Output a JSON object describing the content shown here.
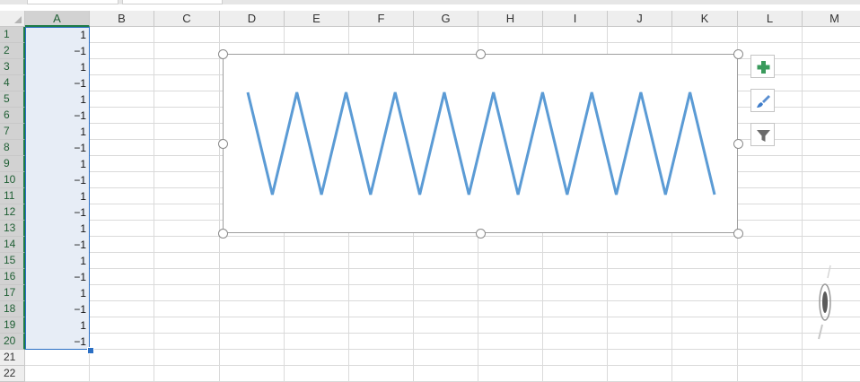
{
  "columns": [
    "A",
    "B",
    "C",
    "D",
    "E",
    "F",
    "G",
    "H",
    "I",
    "J",
    "K",
    "L",
    "M"
  ],
  "selected_column": "A",
  "rows": [
    "1",
    "2",
    "3",
    "4",
    "5",
    "6",
    "7",
    "8",
    "9",
    "10",
    "11",
    "12",
    "13",
    "14",
    "15",
    "16",
    "17",
    "18",
    "19",
    "20",
    "21",
    "22"
  ],
  "column_a_values": [
    "1",
    "−1",
    "1",
    "−1",
    "1",
    "−1",
    "1",
    "−1",
    "1",
    "−1",
    "1",
    "−1",
    "1",
    "−1",
    "1",
    "−1",
    "1",
    "−1",
    "1",
    "−1"
  ],
  "chart_data": {
    "type": "line",
    "title": "",
    "xlabel": "",
    "ylabel": "",
    "x": [
      1,
      2,
      3,
      4,
      5,
      6,
      7,
      8,
      9,
      10,
      11,
      12,
      13,
      14,
      15,
      16,
      17,
      18,
      19,
      20
    ],
    "series": [
      {
        "values": [
          1,
          -1,
          1,
          -1,
          1,
          -1,
          1,
          -1,
          1,
          -1,
          1,
          -1,
          1,
          -1,
          1,
          -1,
          1,
          -1,
          1,
          -1
        ]
      }
    ],
    "ylim": [
      -1,
      1
    ],
    "axes_visible": false,
    "gridlines": false,
    "legend": "none",
    "line_color": "#5b9bd5"
  },
  "chart_buttons": [
    {
      "name": "chart-elements-button",
      "icon": "plus-icon"
    },
    {
      "name": "chart-styles-button",
      "icon": "paintbrush-icon"
    },
    {
      "name": "chart-filters-button",
      "icon": "funnel-icon"
    }
  ],
  "colors": {
    "selection_border": "#2b6fc4",
    "selection_fill": "#e7edf6",
    "excel_green": "#1d7b45",
    "plus_green": "#3a9a5c",
    "brush_blue": "#3d7cc9"
  }
}
